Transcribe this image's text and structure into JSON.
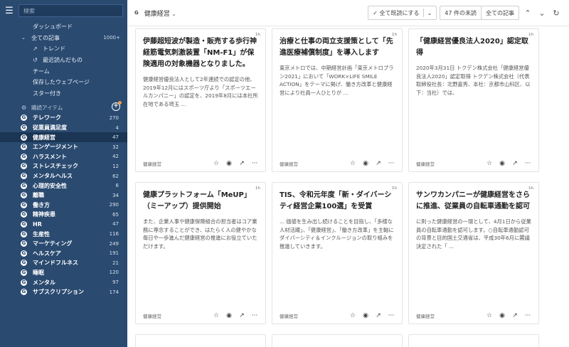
{
  "sidebar": {
    "search_placeholder": "検索",
    "nav": [
      {
        "label": "ダッシュボード"
      },
      {
        "label": "全ての記事",
        "count": "1000+"
      },
      {
        "label": "トレンド"
      },
      {
        "label": "最近読んだもの"
      },
      {
        "label": "チーム"
      },
      {
        "label": "保存したウェブページ"
      },
      {
        "label": "スター付き"
      }
    ],
    "section_label": "購読アイテム",
    "feeds": [
      {
        "label": "テレワーク",
        "count": "270"
      },
      {
        "label": "従業員満足度",
        "count": "4"
      },
      {
        "label": "健康経営",
        "count": "47"
      },
      {
        "label": "エンゲージメント",
        "count": "32"
      },
      {
        "label": "ハラスメント",
        "count": "42"
      },
      {
        "label": "ストレスチェック",
        "count": "12"
      },
      {
        "label": "メンタルヘルス",
        "count": "62"
      },
      {
        "label": "心理的安全性",
        "count": "6"
      },
      {
        "label": "離職",
        "count": "34"
      },
      {
        "label": "働き方",
        "count": "290"
      },
      {
        "label": "精神疾患",
        "count": "65"
      },
      {
        "label": "HR",
        "count": "47"
      },
      {
        "label": "生産性",
        "count": "116"
      },
      {
        "label": "マーケティング",
        "count": "249"
      },
      {
        "label": "ヘルスケア",
        "count": "191"
      },
      {
        "label": "マインドフルネス",
        "count": "21"
      },
      {
        "label": "睡眠",
        "count": "120"
      },
      {
        "label": "メンタル",
        "count": "97"
      },
      {
        "label": "サブスクリプション",
        "count": "174"
      }
    ]
  },
  "header": {
    "title": "健康経営",
    "mark_read_label": "全て既読にする",
    "unread_count_label": "47 件の未読",
    "all_articles_label": "全ての記事"
  },
  "cards": [
    {
      "age": "1h",
      "title": "伊藤超短波が製造・販売する歩行神経筋電気刺激装置「NM-F1」が保険適用の対象機器となりました。",
      "excerpt": "健康経営優良法人として2年連続での認定の他、2019年12月にはスポーツ庁より「スポーツエールカンパニー」の認定を、2019年8月には本社所在地である埼玉 ...",
      "source": "健康経営"
    },
    {
      "age": "1h",
      "title": "治療と仕事の両立支援策として「先進医療補償制度」を導入します",
      "excerpt": "東京メトロでは、中期経営計画「東京メトロプラン2021」において「WORK×LIFE SMILE ACTION」をテーマに掲げ、働き方改革と健康経営により社員一人ひとりが ...",
      "source": "健康経営"
    },
    {
      "age": "1h",
      "title": "「健康経営優良法人2020」認定取得",
      "excerpt": "2020年3月31日 トクデン株式会社「健康経営優良法人2020」認定取得 トクデン株式会社（代表取締役社長：北野嘉秀、本社：京都市山科区、以下：当社）では、",
      "source": "健康経営"
    },
    {
      "age": "1h",
      "title": "健康プラットフォーム「MeUP」（ミーアップ）提供開始",
      "excerpt": "また、企業人事や健康保険組合の担当者はコア業務に専念することができ、はたらく人の健やかな毎日や一歩進んだ健康経営の推進にお役立ていただけます。",
      "source": "健康経営"
    },
    {
      "age": "1h",
      "title": "TIS、令和元年度「新・ダイバーシティ経営企業100選」を受賞",
      "excerpt": "... 価値を生み出し続けることを目指し、「多様な人材活躍」、「健康経営」、「働き方改革」を主軸にダイバーシティ＆インクルージョンの取り組みを推進していきます。",
      "source": "健康経営"
    },
    {
      "age": "1h",
      "title": "サンワカンパニーが健康経営をさらに推進、従業員の自転車通勤を認可",
      "excerpt": "に則った健康経営の一環として、4月1日から従業員の自転車通勤を認可します。○自転車通勤認可の背景と目的国土交通省は、平成30年6月に閣議決定された「 ...",
      "source": "健康経営"
    }
  ]
}
